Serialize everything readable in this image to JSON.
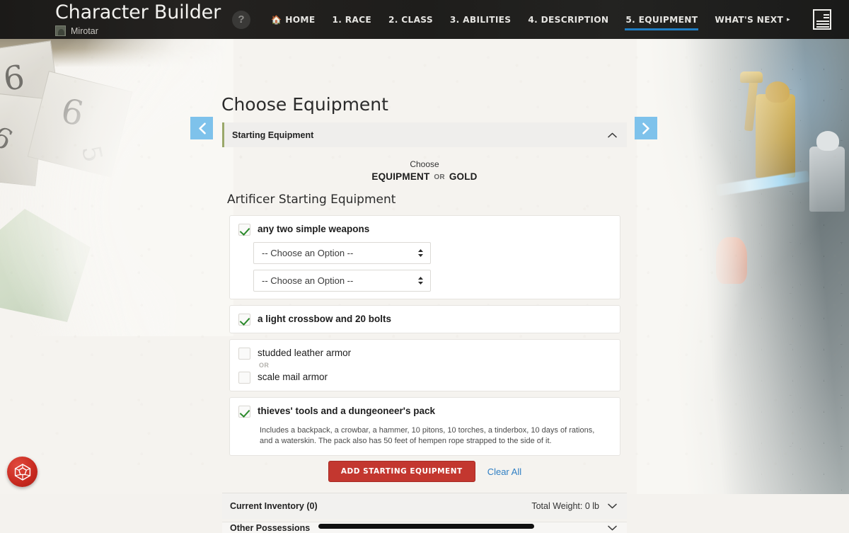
{
  "header": {
    "app_title": "Character Builder",
    "character_name": "Mirotar",
    "avatar_icon": "user-silhouette-icon",
    "help_icon": "question-mark-icon",
    "sheet_icon": "character-sheet-icon",
    "nav": [
      {
        "label": "HOME",
        "icon": "home-icon",
        "active": false
      },
      {
        "label": "1. RACE",
        "active": false
      },
      {
        "label": "2. CLASS",
        "active": false
      },
      {
        "label": "3. ABILITIES",
        "active": false
      },
      {
        "label": "4. DESCRIPTION",
        "active": false
      },
      {
        "label": "5. EQUIPMENT",
        "active": true
      },
      {
        "label": "WHAT'S NEXT",
        "caret": "▸",
        "active": false
      }
    ],
    "active_tab_color": "#1f7ec4"
  },
  "main": {
    "page_title": "Choose Equipment",
    "prev_label": "previous-step",
    "next_label": "next-step",
    "panel": {
      "title": "Starting Equipment",
      "collapse_icon": "chevron-up-icon",
      "accent_color": "#9aa86a"
    },
    "choose": {
      "label": "Choose",
      "equipment_label": "EQUIPMENT",
      "or_label": "OR",
      "gold_label": "GOLD"
    },
    "section_title": "Artificer Starting Equipment",
    "options": [
      {
        "label": "any two simple weapons",
        "checked": true,
        "bold": true,
        "selects": [
          {
            "value": "-- Choose an Option --"
          },
          {
            "value": "-- Choose an Option --"
          }
        ]
      },
      {
        "label": "a light crossbow and 20 bolts",
        "checked": true,
        "bold": true
      },
      {
        "label": "studded leather armor",
        "checked": false,
        "bold": false,
        "or_label": "OR",
        "alt_label": "scale mail armor",
        "alt_checked": false
      },
      {
        "label": "thieves' tools and a dungeoneer's pack",
        "checked": true,
        "bold": true,
        "description": "Includes a backpack, a crowbar, a hammer, 10 pitons, 10 torches, a tinderbox, 10 days of rations, and a waterskin. The pack also has 50 feet of hempen rope strapped to the side of it."
      }
    ],
    "actions": {
      "add_label": "ADD STARTING EQUIPMENT",
      "add_color": "#c3372f",
      "clear_label": "Clear All",
      "clear_color": "#2f7fc4"
    },
    "inventory": {
      "title": "Current Inventory (0)",
      "weight": "Total Weight: 0 lb",
      "expand_icon": "chevron-down-icon"
    },
    "other_possessions": {
      "title": "Other Possessions",
      "expand_icon": "chevron-down-icon"
    }
  },
  "dice_fab": {
    "icon": "d20-dice-icon",
    "color": "#c7291f"
  }
}
